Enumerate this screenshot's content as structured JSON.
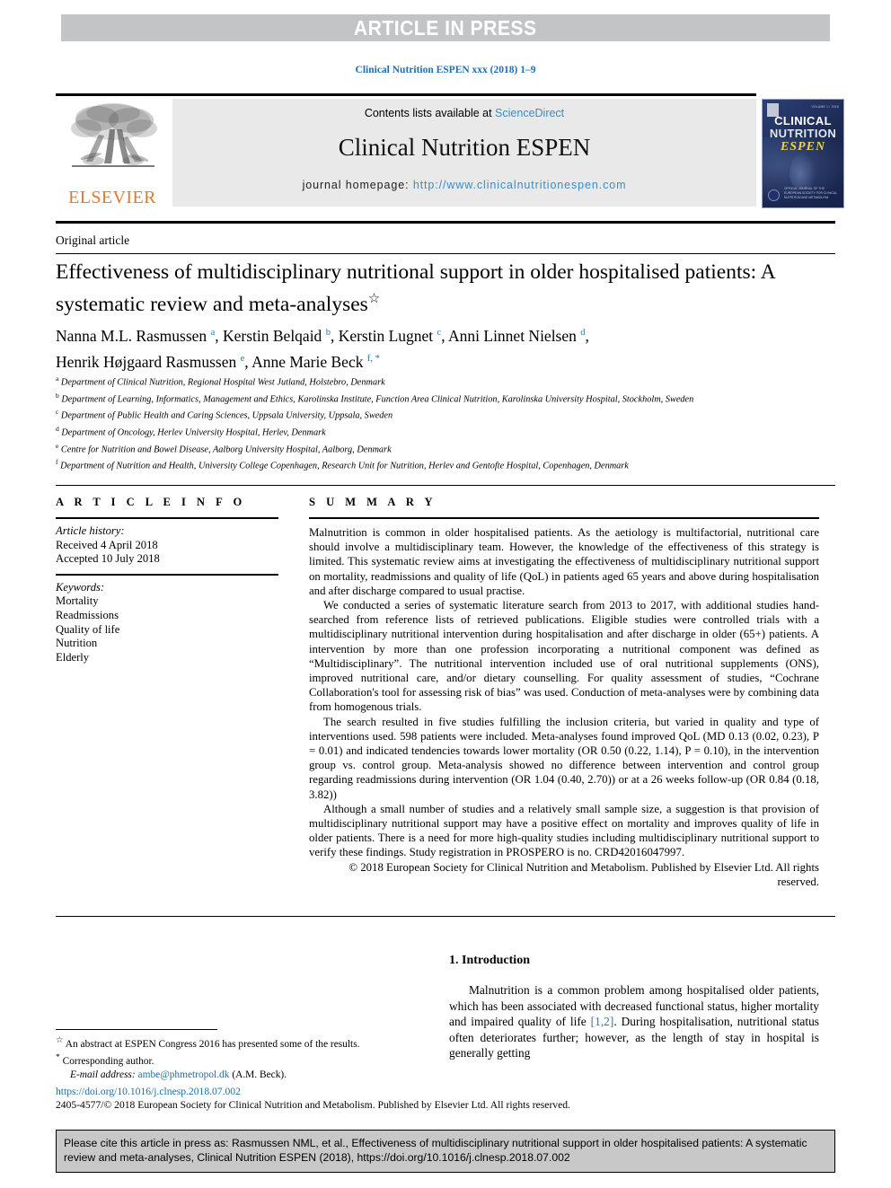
{
  "banner": {
    "text": "ARTICLE IN PRESS"
  },
  "running_head": "Clinical Nutrition ESPEN xxx (2018) 1–9",
  "masthead": {
    "contents_prefix": "Contents lists available at ",
    "contents_link": "ScienceDirect",
    "journal_name": "Clinical Nutrition ESPEN",
    "homepage_prefix": "journal homepage: ",
    "homepage_link": "http://www.clinicalnutritionespen.com",
    "publisher_logo_text": "ELSEVIER",
    "cover": {
      "line1": "CLINICAL",
      "line2": "NUTRITION",
      "line3": "ESPEN",
      "top_right": "VOLUME 1 / 2018",
      "footer": "OFFICIAL JOURNAL OF THE EUROPEAN SOCIETY FOR CLINICAL NUTRITION AND METABOLISM"
    }
  },
  "article": {
    "type_label": "Original article",
    "title": "Effectiveness of multidisciplinary nutritional support in older hospitalised patients: A systematic review and meta-analyses",
    "title_footnote_marker": "☆",
    "authors": [
      {
        "name": "Nanna M.L. Rasmussen",
        "marks": "a"
      },
      {
        "name": "Kerstin Belqaid",
        "marks": "b"
      },
      {
        "name": "Kerstin Lugnet",
        "marks": "c"
      },
      {
        "name": "Anni Linnet Nielsen",
        "marks": "d"
      },
      {
        "name": "Henrik Højgaard Rasmussen",
        "marks": "e"
      },
      {
        "name": "Anne Marie Beck",
        "marks": "f, *"
      }
    ],
    "affiliations": [
      {
        "mark": "a",
        "text": "Department of Clinical Nutrition, Regional Hospital West Jutland, Holstebro, Denmark"
      },
      {
        "mark": "b",
        "text": "Department of Learning, Informatics, Management and Ethics, Karolinska Institute, Function Area Clinical Nutrition, Karolinska University Hospital, Stockholm, Sweden"
      },
      {
        "mark": "c",
        "text": "Department of Public Health and Caring Sciences, Uppsala University, Uppsala, Sweden"
      },
      {
        "mark": "d",
        "text": "Department of Oncology, Herlev University Hospital, Herlev, Denmark"
      },
      {
        "mark": "e",
        "text": "Centre for Nutrition and Bowel Disease, Aalborg University Hospital, Aalborg, Denmark"
      },
      {
        "mark": "f",
        "text": "Department of Nutrition and Health, University College Copenhagen, Research Unit for Nutrition, Herlev and Gentofte Hospital, Copenhagen, Denmark"
      }
    ]
  },
  "article_info": {
    "heading": "A R T I C L E  I N F O",
    "history_label": "Article history:",
    "received": "Received 4 April 2018",
    "accepted": "Accepted 10 July 2018",
    "keywords_label": "Keywords:",
    "keywords": [
      "Mortality",
      "Readmissions",
      "Quality of life",
      "Nutrition",
      "Elderly"
    ]
  },
  "summary": {
    "heading": "S U M M A R Y",
    "paragraphs": [
      "Malnutrition is common in older hospitalised patients. As the aetiology is multifactorial, nutritional care should involve a multidisciplinary team. However, the knowledge of the effectiveness of this strategy is limited. This systematic review aims at investigating the effectiveness of multidisciplinary nutritional support on mortality, readmissions and quality of life (QoL) in patients aged 65 years and above during hospitalisation and after discharge compared to usual practise.",
      "We conducted a series of systematic literature search from 2013 to 2017, with additional studies hand-searched from reference lists of retrieved publications. Eligible studies were controlled trials with a multidisciplinary nutritional intervention during hospitalisation and after discharge in older (65+) patients. A intervention by more than one profession incorporating a nutritional component was defined as “Multidisciplinary”. The nutritional intervention included use of oral nutritional supplements (ONS), improved nutritional care, and/or dietary counselling. For quality assessment of studies, “Cochrane Collaboration's tool for assessing risk of bias” was used. Conduction of meta-analyses were by combining data from homogenous trials.",
      "The search resulted in five studies fulfilling the inclusion criteria, but varied in quality and type of interventions used. 598 patients were included. Meta-analyses found improved QoL (MD 0.13 (0.02, 0.23), P = 0.01) and indicated tendencies towards lower mortality (OR 0.50 (0.22, 1.14), P = 0.10), in the intervention group vs. control group. Meta-analysis showed no difference between intervention and control group regarding readmissions during intervention (OR 1.04 (0.40, 2.70)) or at a 26 weeks follow-up (OR 0.84 (0.18, 3.82))",
      "Although a small number of studies and a relatively small sample size, a suggestion is that provision of multidisciplinary nutritional support may have a positive effect on mortality and improves quality of life in older patients. There is a need for more high-quality studies including multidisciplinary nutritional support to verify these findings. Study registration in PROSPERO is no. CRD42016047997."
    ],
    "copyright": "© 2018 European Society for Clinical Nutrition and Metabolism. Published by Elsevier Ltd. All rights reserved."
  },
  "introduction": {
    "heading": "1. Introduction",
    "text_before_ref": "Malnutrition is a common problem among hospitalised older patients, which has been associated with decreased functional status, higher mortality and impaired quality of life ",
    "reference": "[1,2]",
    "text_after_ref": ". During hospitalisation, nutritional status often deteriorates further; however, as the length of stay in hospital is generally getting"
  },
  "footnotes": {
    "star_marker": "☆",
    "star_text": "An abstract at ESPEN Congress 2016 has presented some of the results.",
    "corr_marker": "*",
    "corr_text": "Corresponding author.",
    "email_label": "E-mail address:",
    "email": "ambe@phmetropol.dk",
    "email_attrib": "(A.M. Beck)."
  },
  "doi_block": {
    "doi_url": "https://doi.org/10.1016/j.clnesp.2018.07.002",
    "issn_line": "2405-4577/© 2018 European Society for Clinical Nutrition and Metabolism. Published by Elsevier Ltd. All rights reserved."
  },
  "cite_box": {
    "text": "Please cite this article in press as: Rasmussen NML, et al., Effectiveness of multidisciplinary nutritional support in older hospitalised patients: A systematic review and meta-analyses, Clinical Nutrition ESPEN (2018), https://doi.org/10.1016/j.clnesp.2018.07.002"
  },
  "colors": {
    "link_blue": "#3a8dc4",
    "elsevier_orange": "#e87722",
    "banner_gray": "#c3c4c6",
    "masthead_gray": "#e9e9e9",
    "cite_gray": "#c8c8c8"
  }
}
